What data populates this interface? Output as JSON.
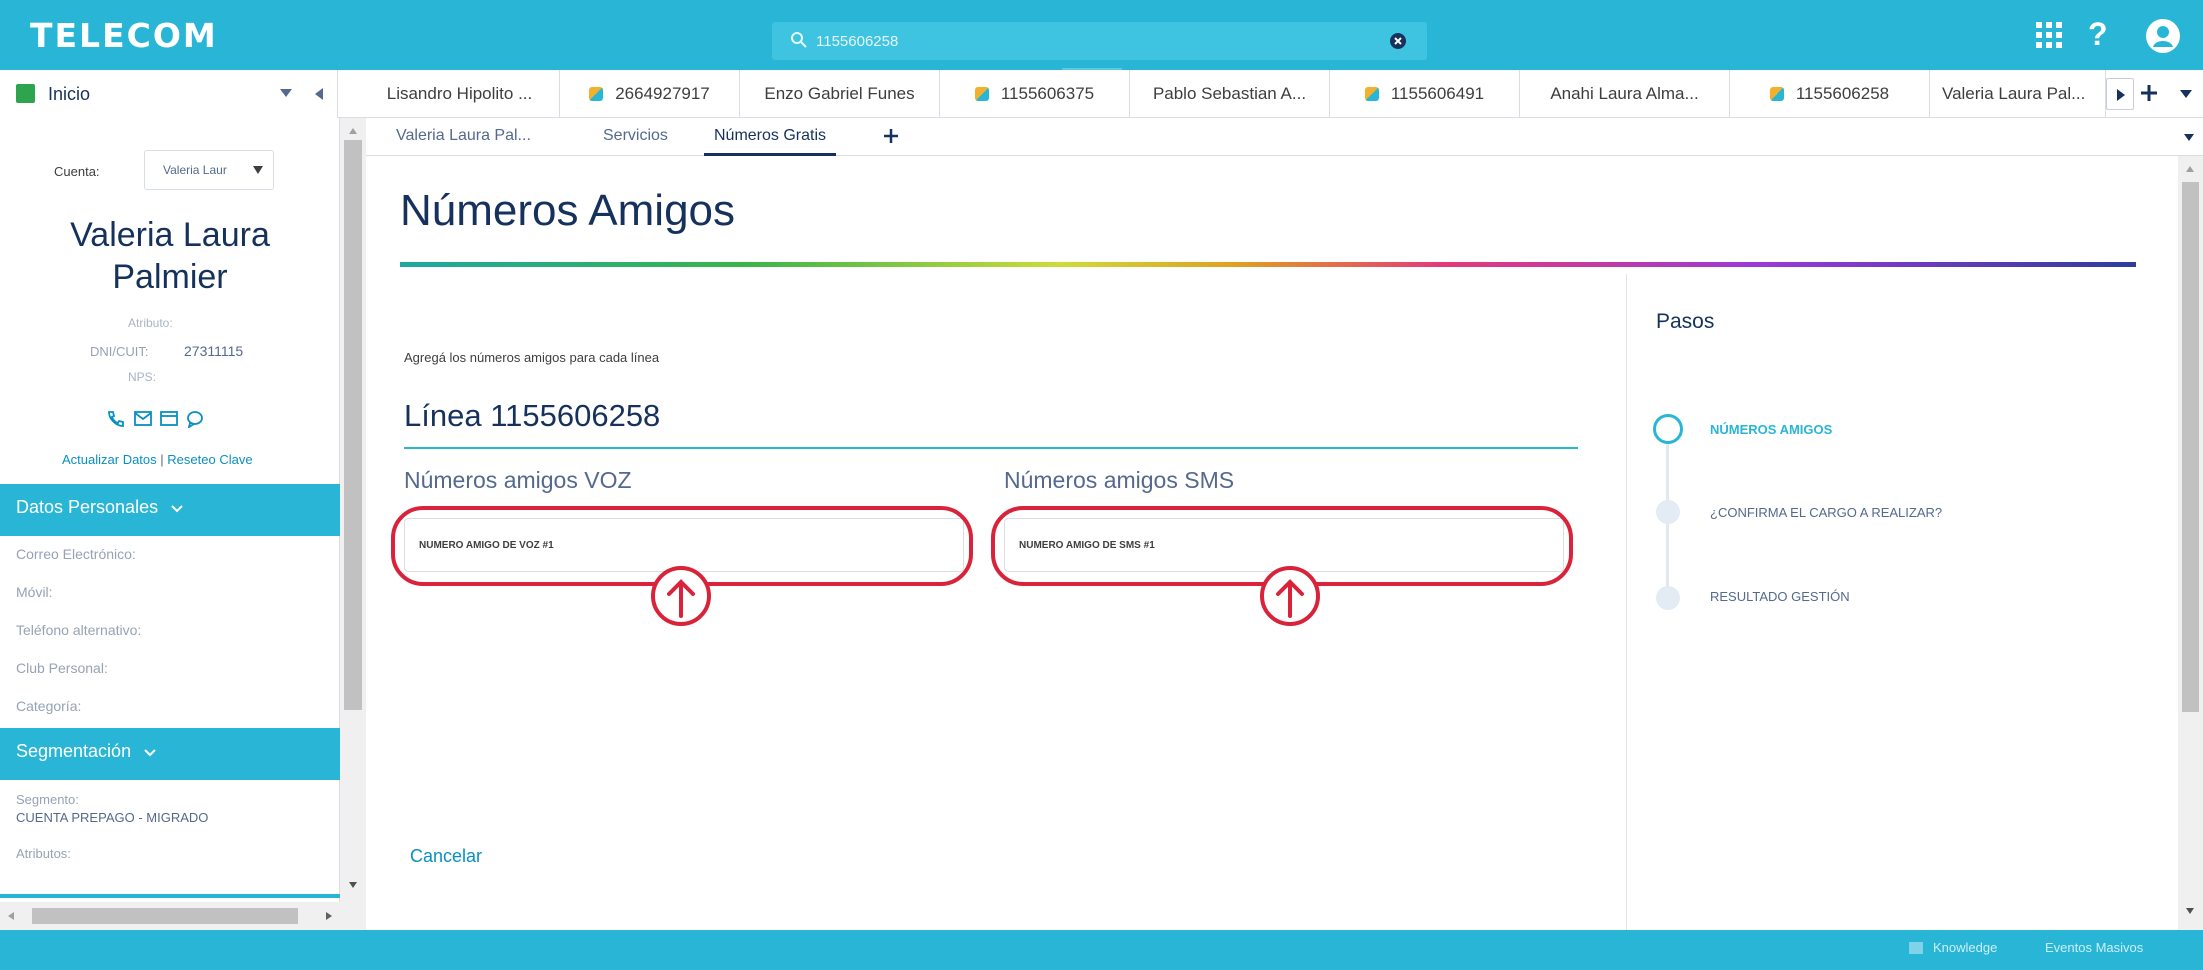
{
  "header": {
    "brand": "TELECOM",
    "search_value": "1155606258",
    "brand_color": "#29b6d6"
  },
  "tabs": {
    "home_label": "Inicio",
    "items": [
      {
        "label": "Lisandro Hipolito ...",
        "icon": false
      },
      {
        "label": "2664927917",
        "icon": true
      },
      {
        "label": "Enzo Gabriel Funes",
        "icon": false
      },
      {
        "label": "1155606375",
        "icon": true
      },
      {
        "label": "Pablo Sebastian A...",
        "icon": false
      },
      {
        "label": "1155606491",
        "icon": true
      },
      {
        "label": "Anahi Laura Alma...",
        "icon": false
      },
      {
        "label": "1155606258",
        "icon": true
      },
      {
        "label": "Valeria Laura Pal...",
        "icon": false
      }
    ]
  },
  "sidebar": {
    "cuenta_label": "Cuenta:",
    "cuenta_value": "Valeria Laur",
    "name_line1": "Valeria Laura",
    "name_line2": "Palmier",
    "atributo_label": "Atributo:",
    "dni_label": "DNI/CUIT:",
    "dni_value": "27311115",
    "nps_label": "NPS:",
    "link_actualizar": "Actualizar Datos",
    "link_sep": "|",
    "link_reseteo": "Reseteo Clave",
    "section_personales": "Datos Personales",
    "fields": [
      "Correo Electrónico:",
      "Móvil:",
      "Teléfono alternativo:",
      "Club Personal:",
      "Categoría:"
    ],
    "section_segmentacion": "Segmentación",
    "segmento_label": "Segmento:",
    "segmento_value": "CUENTA PREPAGO - MIGRADO",
    "atributos_label": "Atributos:"
  },
  "subtabs": [
    "Valeria Laura Pal...",
    "Servicios",
    "Números Gratis"
  ],
  "main": {
    "title": "Números Amigos",
    "intro": "Agregá los números amigos para cada línea",
    "linea": "Línea 1155606258",
    "voz_title": "Números amigos VOZ",
    "sms_title": "Números amigos SMS",
    "voz_placeholder": "NUMERO AMIGO DE VOZ #1",
    "sms_placeholder": "NUMERO AMIGO DE SMS #1",
    "cancel": "Cancelar"
  },
  "steps": {
    "title": "Pasos",
    "items": [
      "NÚMEROS AMIGOS",
      "¿CONFIRMA EL CARGO A REALIZAR?",
      "RESULTADO GESTIÓN"
    ]
  },
  "footer": {
    "knowledge": "Knowledge",
    "eventos": "Eventos Masivos"
  }
}
